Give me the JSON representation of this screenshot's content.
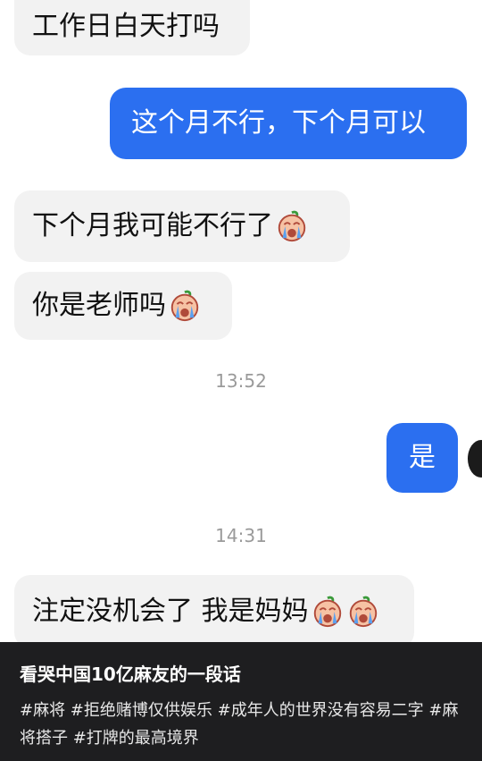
{
  "messages": [
    {
      "text": "工作日白天打吗"
    },
    {
      "text": "这个月不行，下个月可以"
    },
    {
      "text": "下个月我可能不行了",
      "emoji": "crying-face-icon"
    },
    {
      "text": "你是老师吗",
      "emoji": "crying-face-icon"
    },
    {
      "text": "是"
    },
    {
      "text": "注定没机会了 我是妈妈",
      "emoji": "crying-face-icon"
    }
  ],
  "timestamps": [
    "13:52",
    "14:31"
  ],
  "caption": {
    "title": "看哭中国10亿麻友的一段话",
    "tags": "#麻将 #拒绝赌博仅供娱乐 #成年人的世界没有容易二字 #麻将搭子 #打牌的最高境界"
  },
  "colors": {
    "outgoing_bubble": "#2b6ff0",
    "incoming_bubble": "#f2f2f2",
    "caption_background": "#1e1e20"
  }
}
